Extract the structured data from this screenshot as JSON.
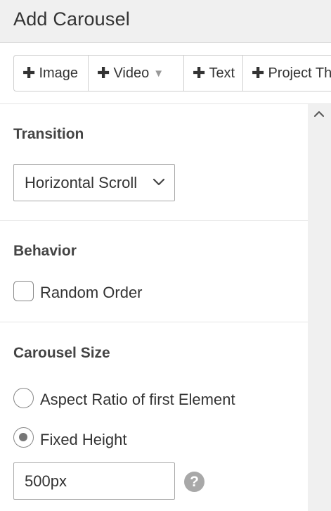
{
  "header": {
    "title": "Add Carousel"
  },
  "toolbar": {
    "image_label": "Image",
    "video_label": "Video",
    "text_label": "Text",
    "project_label": "Project Th"
  },
  "transition": {
    "title": "Transition",
    "selected": "Horizontal Scroll"
  },
  "behavior": {
    "title": "Behavior",
    "random_order_label": "Random Order",
    "random_order_checked": false
  },
  "carousel_size": {
    "title": "Carousel Size",
    "options": [
      {
        "label": "Aspect Ratio of first Element",
        "checked": false
      },
      {
        "label": "Fixed Height",
        "checked": true
      }
    ],
    "height_value": "500px",
    "help_symbol": "?"
  }
}
